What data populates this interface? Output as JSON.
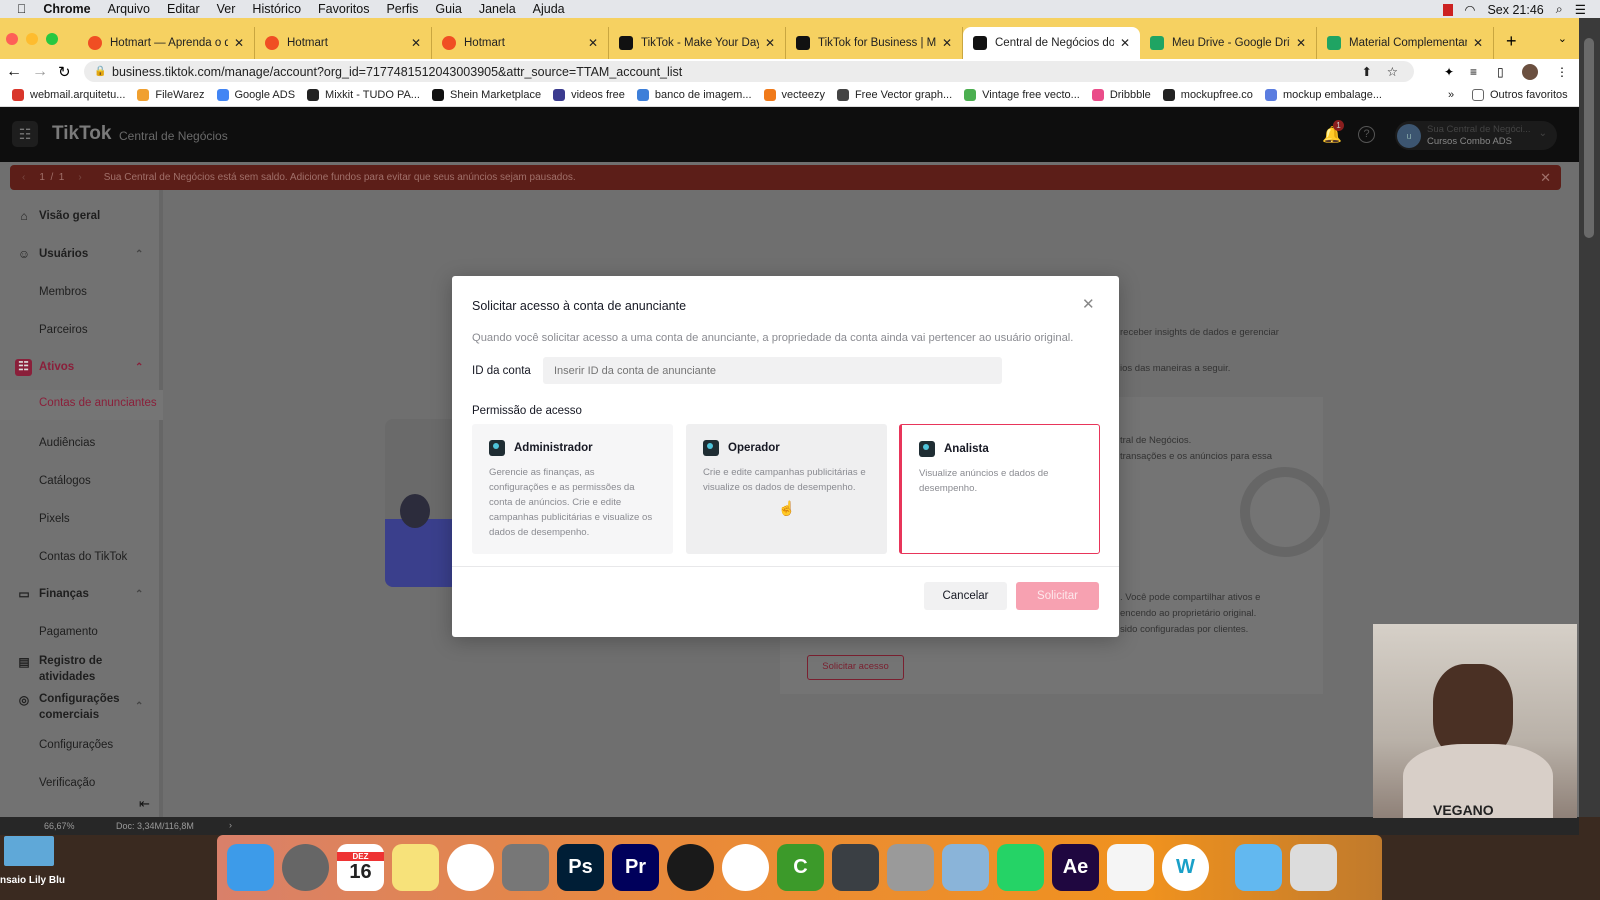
{
  "menubar": {
    "app": "Chrome",
    "items": [
      "Arquivo",
      "Editar",
      "Ver",
      "Histórico",
      "Favoritos",
      "Perfis",
      "Guia",
      "Janela",
      "Ajuda"
    ],
    "clock": "Sex 21:46"
  },
  "tabs": [
    {
      "title": "Hotmart — Aprenda o que",
      "icon": "hotmart-icon",
      "color": "#f04e23"
    },
    {
      "title": "Hotmart",
      "icon": "hotmart-icon",
      "color": "#f04e23"
    },
    {
      "title": "Hotmart",
      "icon": "hotmart-icon",
      "color": "#f04e23"
    },
    {
      "title": "TikTok - Make Your Day",
      "icon": "tiktok-icon",
      "color": "#111111"
    },
    {
      "title": "TikTok for Business | Mark",
      "icon": "tiktok-icon",
      "color": "#111111"
    },
    {
      "title": "Central de Negócios do Ti",
      "icon": "tiktok-icon",
      "color": "#111111",
      "active": true
    },
    {
      "title": "Meu Drive - Google Drive",
      "icon": "google-drive-icon",
      "color": "#1fa463"
    },
    {
      "title": "Material Complementar - (",
      "icon": "google-drive-icon",
      "color": "#1fa463"
    }
  ],
  "address": {
    "url": "business.tiktok.com/manage/account?org_id=7177481512043003905&attr_source=TTAM_account_list"
  },
  "bookmarks": [
    {
      "label": "webmail.arquitetu...",
      "color": "#d9362b"
    },
    {
      "label": "FileWarez",
      "color": "#f0a030"
    },
    {
      "label": "Google ADS",
      "color": "#4285f4"
    },
    {
      "label": "Mixkit - TUDO PA...",
      "color": "#222222"
    },
    {
      "label": "Shein Marketplace",
      "color": "#111111"
    },
    {
      "label": "videos free",
      "color": "#3b3b8f"
    },
    {
      "label": "banco de imagem...",
      "color": "#3d7fd9"
    },
    {
      "label": "vecteezy",
      "color": "#f07a1a"
    },
    {
      "label": "Free Vector graph...",
      "color": "#444444"
    },
    {
      "label": "Vintage free vecto...",
      "color": "#4caf50"
    },
    {
      "label": "Dribbble",
      "color": "#ea4c89"
    },
    {
      "label": "mockupfree.co",
      "color": "#222222"
    },
    {
      "label": "mockup embalage...",
      "color": "#5b7de0"
    }
  ],
  "bookmarks_more": "»",
  "bookmarks_other": "Outros favoritos",
  "tiktok": {
    "logo": "TikTok",
    "product": "Central de Negócios",
    "notifications": "1",
    "account_line1": "Sua Central de Negóci...",
    "account_line2": "Cursos Combo ADS",
    "avatar": "u",
    "banner_pager": "1  /  1",
    "banner_text": "Sua Central de Negócios está sem saldo. Adicione fundos para evitar que seus anúncios sejam pausados."
  },
  "sidebar": [
    {
      "label": "Visão geral",
      "icon": "home-icon",
      "type": "header"
    },
    {
      "label": "Usuários",
      "icon": "users-icon",
      "type": "header",
      "chevron": true
    },
    {
      "label": "Membros",
      "type": "sub"
    },
    {
      "label": "Parceiros",
      "type": "sub"
    },
    {
      "label": "Ativos",
      "icon": "assets-icon",
      "type": "header",
      "chevron": true,
      "active": true
    },
    {
      "label": "Contas de anunciantes",
      "type": "sub",
      "active": true
    },
    {
      "label": "Audiências",
      "type": "sub"
    },
    {
      "label": "Catálogos",
      "type": "sub"
    },
    {
      "label": "Pixels",
      "type": "sub"
    },
    {
      "label": "Contas do TikTok",
      "type": "sub"
    },
    {
      "label": "Finanças",
      "icon": "wallet-icon",
      "type": "header",
      "chevron": true
    },
    {
      "label": "Pagamento",
      "type": "sub"
    },
    {
      "label": "Registro de atividades",
      "icon": "document-icon",
      "type": "header"
    },
    {
      "label": "Configurações comerciais",
      "icon": "settings-icon",
      "type": "header",
      "chevron": true
    },
    {
      "label": "Configurações",
      "type": "sub"
    },
    {
      "label": "Verificação",
      "type": "sub"
    }
  ],
  "background": {
    "line1": "receber insights de dados e gerenciar",
    "line2": "ios das maneiras a seguir.",
    "line3": "tral de Negócios.",
    "line4": "transações e os anúncios para essa",
    "line5": ". Você pode compartilhar ativos e",
    "line6": "encendo ao proprietário original.",
    "line7": "sido configuradas por clientes.",
    "request_button": "Solicitar acesso"
  },
  "modal": {
    "title": "Solicitar acesso à conta de anunciante",
    "description": "Quando você solicitar acesso a uma conta de anunciante, a propriedade da conta ainda vai pertencer ao usuário original.",
    "id_label": "ID da conta",
    "id_placeholder": "Inserir ID da conta de anunciante",
    "id_value": "",
    "permission_label": "Permissão de acesso",
    "options": [
      {
        "title": "Administrador",
        "description": "Gerencie as finanças, as configurações e as permissões da conta de anúncios. Crie e edite campanhas publicitárias e visualize os dados de desempenho."
      },
      {
        "title": "Operador",
        "description": "Crie e edite campanhas publicitárias e visualize os dados de desempenho."
      },
      {
        "title": "Analista",
        "description": "Visualize anúncios e dados de desempenho.",
        "selected": true
      }
    ],
    "cancel": "Cancelar",
    "submit": "Solicitar",
    "accent": "#fe2c55"
  },
  "status": {
    "zoom": "66,67%",
    "doc": "Doc: 3,34M/116,8M"
  },
  "desktop": {
    "folder_label": "nsaio Lily Blu"
  },
  "dock": [
    {
      "name": "finder",
      "label": "",
      "color": "#3d9be9"
    },
    {
      "name": "launchpad",
      "label": "",
      "color": "#666666"
    },
    {
      "name": "calendar",
      "label": "16",
      "month": "DEZ",
      "color": "#ffffff"
    },
    {
      "name": "notes",
      "label": "",
      "color": "#f7e27a"
    },
    {
      "name": "photos",
      "label": "",
      "color": "#ffffff"
    },
    {
      "name": "system-preferences",
      "label": "",
      "color": "#777777"
    },
    {
      "name": "photoshop",
      "label": "Ps",
      "color": "#001e36"
    },
    {
      "name": "premiere",
      "label": "Pr",
      "color": "#00005b"
    },
    {
      "name": "vectornator",
      "label": "",
      "color": "#1a1a1a"
    },
    {
      "name": "chrome",
      "label": "",
      "color": "#ffffff"
    },
    {
      "name": "camtasia",
      "label": "C",
      "color": "#3c9a2a"
    },
    {
      "name": "fan-control",
      "label": "",
      "color": "#3a3f44"
    },
    {
      "name": "calculator",
      "label": "",
      "color": "#9a9a9a"
    },
    {
      "name": "preview",
      "label": "",
      "color": "#8ab4d9"
    },
    {
      "name": "whatsapp",
      "label": "",
      "color": "#25d366"
    },
    {
      "name": "after-effects",
      "label": "Ae",
      "color": "#1f0740"
    },
    {
      "name": "textedit",
      "label": "",
      "color": "#f5f5f5"
    },
    {
      "name": "wondershare",
      "label": "W",
      "color": "#ffffff"
    },
    {
      "name": "folder",
      "label": "",
      "color": "#62b8f0"
    },
    {
      "name": "trash",
      "label": "",
      "color": "#dcdcdc"
    }
  ],
  "webcam": {
    "shirt_text": "VEGANO"
  }
}
